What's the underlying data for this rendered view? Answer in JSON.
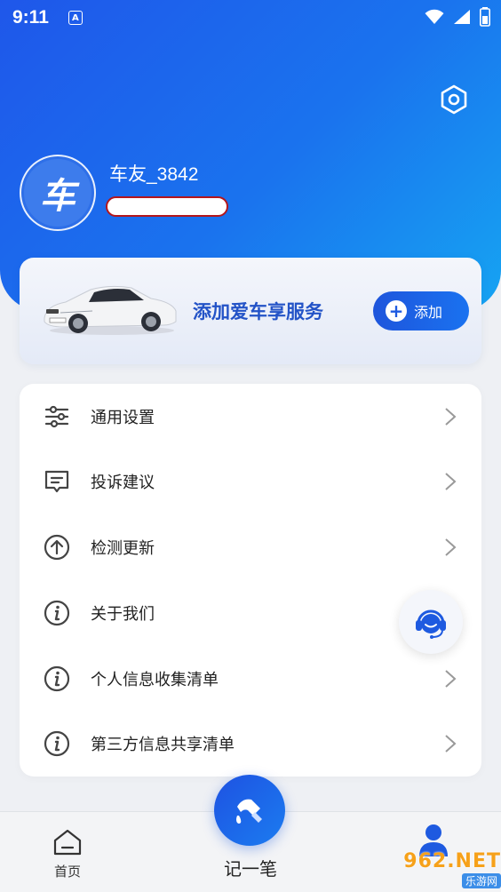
{
  "status_bar": {
    "time": "9:11",
    "notif": "A"
  },
  "header": {
    "avatar_text": "车",
    "username": "车友_3842",
    "settings_icon": "settings-hexagon-icon"
  },
  "car_card": {
    "title": "添加爱车享服务",
    "add_label": "添加"
  },
  "menu": {
    "items": [
      {
        "label": "通用设置",
        "icon": "sliders-icon",
        "chevron": true
      },
      {
        "label": "投诉建议",
        "icon": "feedback-icon",
        "chevron": true
      },
      {
        "label": "检测更新",
        "icon": "update-arrow-icon",
        "chevron": true
      },
      {
        "label": "关于我们",
        "icon": "info-icon",
        "chevron": false
      },
      {
        "label": "个人信息收集清单",
        "icon": "info-icon",
        "chevron": true
      },
      {
        "label": "第三方信息共享清单",
        "icon": "info-icon",
        "chevron": true
      }
    ]
  },
  "bottom_nav": {
    "home_label": "首页",
    "center_label": "记一笔",
    "mine_icon": "person-icon"
  },
  "watermark": {
    "main": "962.NET",
    "sub": "乐游网"
  },
  "colors": {
    "primary": "#1e5ae0",
    "header_gradient_end": "#16a4f2"
  }
}
